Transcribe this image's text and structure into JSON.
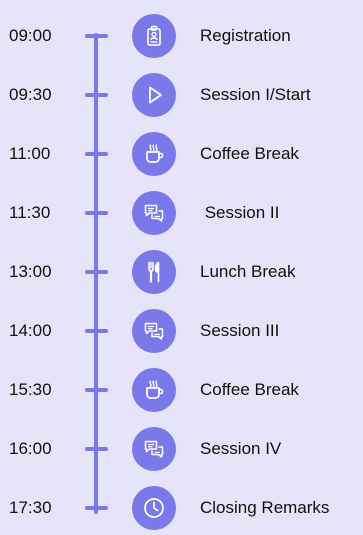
{
  "colors": {
    "background": "#e5e4f9",
    "accent": "#7b78ea",
    "icon_stroke": "#ffffff",
    "text": "#101010"
  },
  "schedule": [
    {
      "time": "09:00",
      "label": "Registration",
      "icon": "id-badge-icon"
    },
    {
      "time": "09:30",
      "label": "Session I/Start",
      "icon": "play-icon"
    },
    {
      "time": "11:00",
      "label": "Coffee Break",
      "icon": "coffee-cup-icon"
    },
    {
      "time": "11:30",
      "label": " Session II",
      "icon": "chat-bubbles-icon"
    },
    {
      "time": "13:00",
      "label": "Lunch Break",
      "icon": "fork-knife-icon"
    },
    {
      "time": "14:00",
      "label": "Session III",
      "icon": "chat-bubbles-icon"
    },
    {
      "time": "15:30",
      "label": "Coffee Break",
      "icon": "coffee-cup-icon"
    },
    {
      "time": "16:00",
      "label": "Session IV",
      "icon": "chat-bubbles-icon"
    },
    {
      "time": "17:30",
      "label": "Closing Remarks",
      "icon": "clock-icon"
    }
  ]
}
